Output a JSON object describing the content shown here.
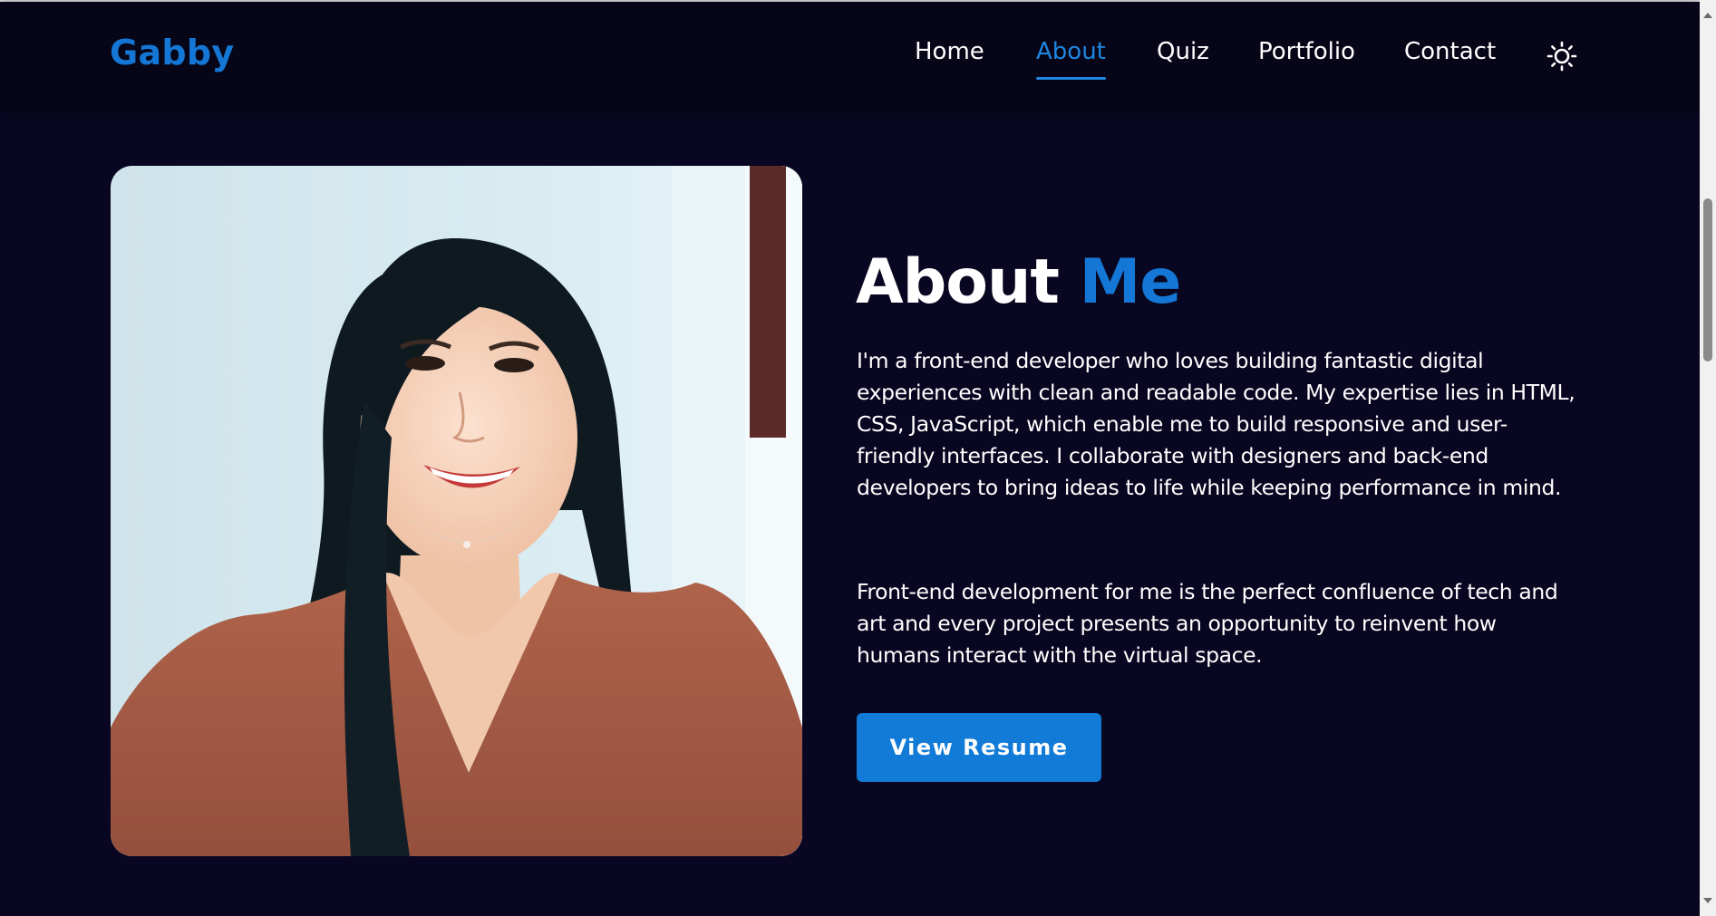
{
  "header": {
    "logo": "Gabby",
    "nav": {
      "home": "Home",
      "about": "About",
      "quiz": "Quiz",
      "portfolio": "Portfolio",
      "contact": "Contact",
      "active": "About"
    },
    "theme_toggle_icon": "sun-icon"
  },
  "about": {
    "title_part1": "About",
    "title_part2": "Me",
    "paragraph1": "I'm a front-end developer who loves building fantastic digital experiences with clean and readable code. My expertise lies in HTML, CSS, JavaScript, which enable me to build responsive and user-friendly interfaces. I collaborate with designers and back-end developers to bring ideas to life while keeping performance in mind.",
    "paragraph2": "Front-end development for me is the perfect confluence of tech and art and every project presents an opportunity to reinvent how humans interact with the virtual space.",
    "button_label": "View Resume"
  },
  "colors": {
    "background": "#080620",
    "accent": "#1477d6",
    "button": "#117bd7",
    "text": "#ffffff"
  }
}
